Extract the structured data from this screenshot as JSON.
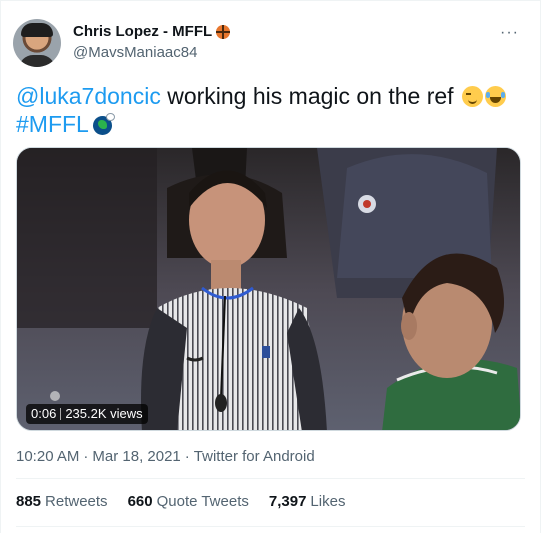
{
  "author": {
    "display_name": "Chris Lopez - MFFL",
    "handle": "@MavsManiaac84",
    "badge_icon": "basketball-icon"
  },
  "tweet": {
    "mention": "@luka7doncic",
    "text": " working his magic on the ref",
    "emojis": [
      "smirking-face-icon",
      "face-with-tears-of-joy-icon"
    ],
    "hashtag": "#MFFL",
    "hashtag_icon": "mavericks-logo-icon"
  },
  "video": {
    "elapsed": "0:06",
    "views": "235.2K views"
  },
  "meta": {
    "time": "10:20 AM",
    "date": "Mar 18, 2021",
    "source": "Twitter for Android"
  },
  "stats": {
    "retweets_count": "885",
    "retweets_label": "Retweets",
    "quotes_count": "660",
    "quotes_label": "Quote Tweets",
    "likes_count": "7,397",
    "likes_label": "Likes"
  },
  "colors": {
    "link": "#1d9bf0",
    "secondary_text": "#536471",
    "primary_text": "#0f1419"
  }
}
